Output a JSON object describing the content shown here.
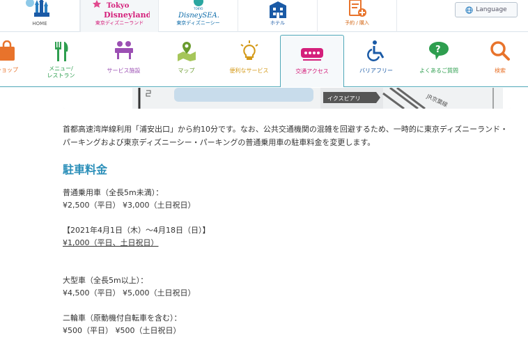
{
  "topnav": {
    "items": [
      {
        "label": "HOME"
      },
      {
        "label": "東京ディズニーランド",
        "logo_line1": "Tokyo",
        "logo_line2": "Disneyland"
      },
      {
        "label": "東京ディズニーシー",
        "logo_small": "TOKYO",
        "logo_main": "DisneySEA."
      },
      {
        "label": "ホテル"
      },
      {
        "label": "予約 / 購入"
      }
    ],
    "language_label": "Language"
  },
  "subnav": {
    "items": [
      {
        "label": "ショップ",
        "color": "#e8732b"
      },
      {
        "label": "メニュー/\nレストラン",
        "color": "#2e9e4f"
      },
      {
        "label": "サービス施設",
        "color": "#9b4fb3"
      },
      {
        "label": "マップ",
        "color": "#6a9b2e"
      },
      {
        "label": "便利なサービス",
        "color": "#d49a1a"
      },
      {
        "label": "交通アクセス",
        "color": "#d4207b"
      },
      {
        "label": "バリアフリー",
        "color": "#1a5aa6"
      },
      {
        "label": "よくあるご質問",
        "color": "#2e9e4f"
      },
      {
        "label": "検索",
        "color": "#e8732b"
      }
    ]
  },
  "map": {
    "label_ikspiari": "イクスピアリ",
    "label_jr": "JR京葉線"
  },
  "content": {
    "intro": "首都高速湾岸線利用「浦安出口」から約10分です。なお、公共交通機関の混雑を回避するため、一時的に東京ディズニーランド・パーキングおよび東京ディズニーシー・パーキングの普通乗用車の駐車料金を変更します。",
    "section_title": "駐車料金",
    "regular_heading": "普通乗用車（全長5m未満）：",
    "regular_price": "¥2,500（平日） ¥3,000（土日祝日）",
    "special_period": "【2021年4月1日（木）～4月18日（日）】",
    "special_price": "¥1,000（平日、土日祝日）",
    "large_heading": "大型車（全長5m以上）：",
    "large_price": "¥4,500（平日） ¥5,000（土日祝日）",
    "bike_heading": "二輪車（原動機付自転車を含む）：",
    "bike_price": "¥500（平日） ¥500（土日祝日）"
  }
}
